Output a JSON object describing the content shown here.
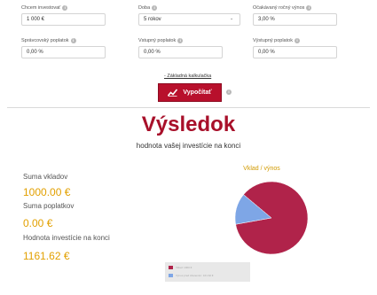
{
  "form": {
    "fields": [
      {
        "label": "Chcem investovať",
        "value": "1 000 €",
        "type": "input"
      },
      {
        "label": "Doba",
        "value": "5 rokov",
        "type": "select"
      },
      {
        "label": "Očakávaný ročný výnos",
        "value": "3,00 %",
        "type": "input"
      },
      {
        "label": "Správcovský poplatok",
        "value": "0,00 %",
        "type": "input"
      },
      {
        "label": "Vstupný poplatok",
        "value": "0,00 %",
        "type": "input"
      },
      {
        "label": "Výstupný poplatok",
        "value": "0,00 %",
        "type": "input"
      }
    ]
  },
  "basic_calc_link": "- Základná kalkulačka",
  "calc_button": "Vypočítať",
  "result": {
    "title": "Výsledok",
    "subtitle": "hodnota vašej investície na konci",
    "stats": [
      {
        "label": "Suma vkladov",
        "value": "1000.00 €"
      },
      {
        "label": "Suma poplatkov",
        "value": "0.00 €"
      },
      {
        "label": "Hodnota investície na konci",
        "value": "1161.62 €"
      }
    ]
  },
  "chart_data": {
    "type": "pie",
    "title": "Vklad / výnos",
    "slices": [
      {
        "name": "Vklad: 1000 €",
        "value": 1000,
        "color": "#b0234a"
      },
      {
        "name": "Výnos pred zdanením: 161.62 €",
        "value": 161.62,
        "color": "#7ea6e6"
      }
    ]
  },
  "colors": {
    "brand": "#b8102c",
    "accent": "#e2a000",
    "title": "#a8102a"
  }
}
